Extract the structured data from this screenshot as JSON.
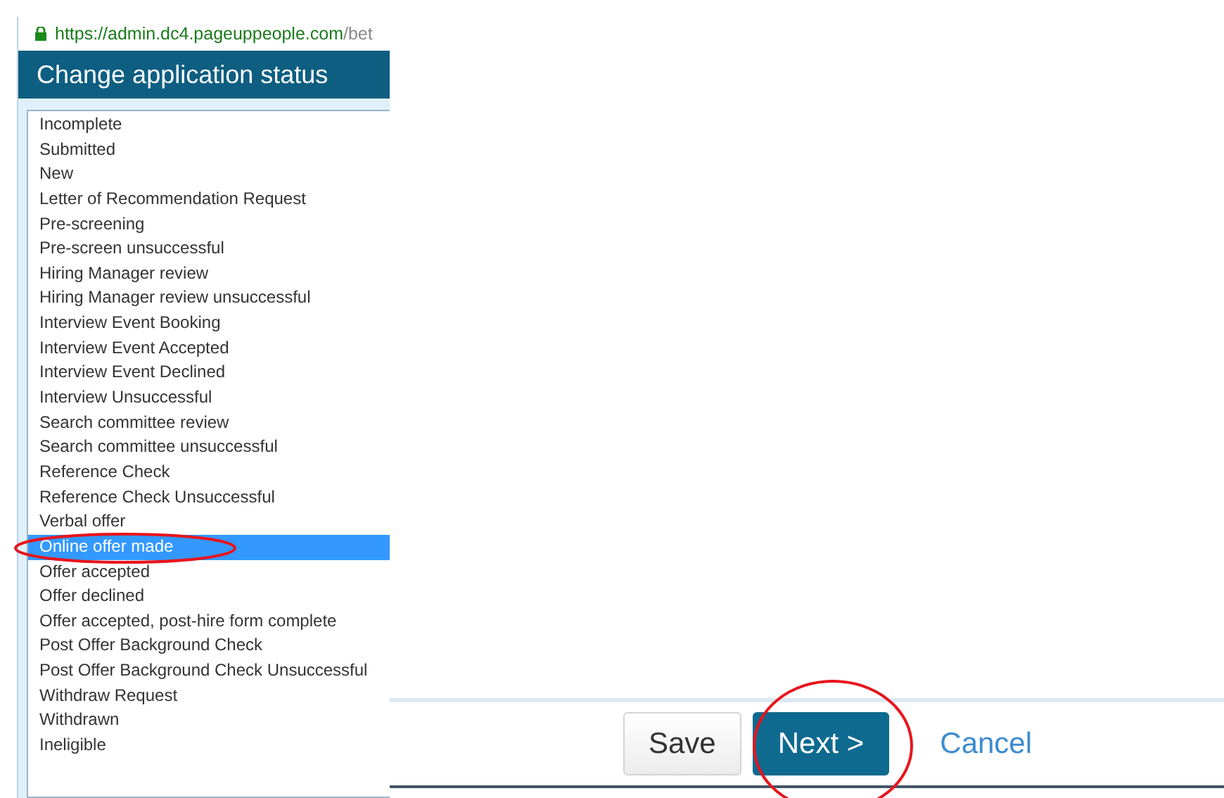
{
  "address_bar": {
    "url_host": "https://admin.dc4.pageuppeople.com",
    "url_path": "/bet"
  },
  "dialog": {
    "title": "Change application status"
  },
  "status_list": [
    {
      "label": "Incomplete",
      "selected": false
    },
    {
      "label": "Submitted",
      "selected": false
    },
    {
      "label": "New",
      "selected": false
    },
    {
      "label": "Letter of Recommendation Request",
      "selected": false
    },
    {
      "label": "Pre-screening",
      "selected": false
    },
    {
      "label": "Pre-screen unsuccessful",
      "selected": false
    },
    {
      "label": "Hiring Manager review",
      "selected": false
    },
    {
      "label": "Hiring Manager review unsuccessful",
      "selected": false
    },
    {
      "label": "Interview Event Booking",
      "selected": false
    },
    {
      "label": "Interview Event Accepted",
      "selected": false
    },
    {
      "label": "Interview Event Declined",
      "selected": false
    },
    {
      "label": "Interview Unsuccessful",
      "selected": false
    },
    {
      "label": "Search committee review",
      "selected": false
    },
    {
      "label": "Search committee unsuccessful",
      "selected": false
    },
    {
      "label": "Reference Check",
      "selected": false
    },
    {
      "label": "Reference Check Unsuccessful",
      "selected": false
    },
    {
      "label": "Verbal offer",
      "selected": false
    },
    {
      "label": "Online offer made",
      "selected": true
    },
    {
      "label": "Offer accepted",
      "selected": false
    },
    {
      "label": "Offer declined",
      "selected": false
    },
    {
      "label": "Offer accepted, post-hire form complete",
      "selected": false
    },
    {
      "label": "Post Offer Background Check",
      "selected": false
    },
    {
      "label": "Post Offer Background Check Unsuccessful",
      "selected": false
    },
    {
      "label": "Withdraw Request",
      "selected": false
    },
    {
      "label": "Withdrawn",
      "selected": false
    },
    {
      "label": "Ineligible",
      "selected": false
    }
  ],
  "buttons": [
    {
      "label": "Save",
      "kind": "secondary"
    },
    {
      "label": "Next >",
      "kind": "primary"
    },
    {
      "label": "Cancel",
      "kind": "link"
    }
  ]
}
